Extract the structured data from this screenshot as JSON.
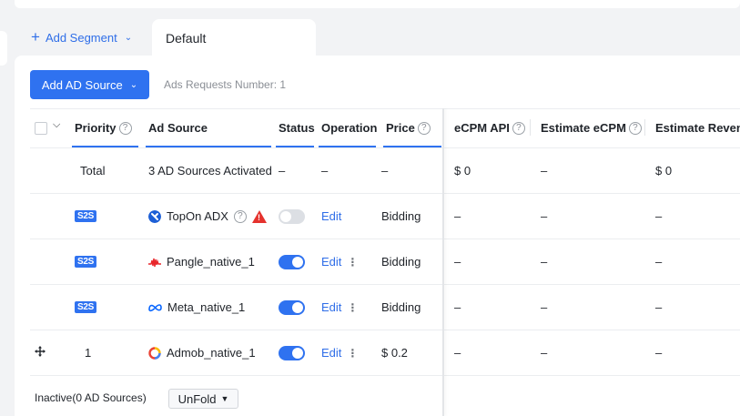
{
  "segment_bar": {
    "add_segment_label": "Add Segment",
    "active_tab_label": "Default"
  },
  "toolbar": {
    "add_source_label": "Add AD Source",
    "requests_text": "Ads Requests Number: 1"
  },
  "table": {
    "headers": {
      "priority": "Priority",
      "ad_source": "Ad Source",
      "status": "Status",
      "operation": "Operation",
      "price": "Price",
      "ecpm_api": "eCPM API",
      "estimate_ecpm": "Estimate eCPM",
      "estimate_revenue": "Estimate Revenu"
    },
    "total_row": {
      "priority": "Total",
      "ad_source": "3 AD Sources Activated",
      "status": "–",
      "operation": "–",
      "price": "–",
      "ecpm_api": "$ 0",
      "estimate_ecpm": "–",
      "estimate_revenue": "$ 0"
    },
    "rows": [
      {
        "badge": "S2S",
        "priority": "",
        "name": "TopOn ADX",
        "status": "off",
        "edit": "Edit",
        "price": "Bidding",
        "ecpm_api": "–",
        "estimate_ecpm": "–",
        "estimate_revenue": "–",
        "logo": "topon-logo",
        "has_help": true,
        "has_warning": true,
        "has_more": false
      },
      {
        "badge": "S2S",
        "priority": "",
        "name": "Pangle_native_1",
        "status": "on",
        "edit": "Edit",
        "price": "Bidding",
        "ecpm_api": "–",
        "estimate_ecpm": "–",
        "estimate_revenue": "–",
        "logo": "pangle-logo",
        "has_more": true
      },
      {
        "badge": "S2S",
        "priority": "",
        "name": "Meta_native_1",
        "status": "on",
        "edit": "Edit",
        "price": "Bidding",
        "ecpm_api": "–",
        "estimate_ecpm": "–",
        "estimate_revenue": "–",
        "logo": "meta-logo",
        "has_more": true
      },
      {
        "badge": "",
        "priority": "1",
        "name": "Admob_native_1",
        "status": "on",
        "edit": "Edit",
        "price": "$ 0.2",
        "ecpm_api": "–",
        "estimate_ecpm": "–",
        "estimate_revenue": "–",
        "logo": "admob-logo",
        "has_more": true,
        "draggable": true
      }
    ],
    "inactive_label": "Inactive(0 AD Sources)",
    "unfold_label": "UnFold"
  },
  "colors": {
    "accent": "#2f72f0",
    "warning": "#e5322d",
    "pangle": "#e8252a",
    "meta": "#0866ff"
  }
}
